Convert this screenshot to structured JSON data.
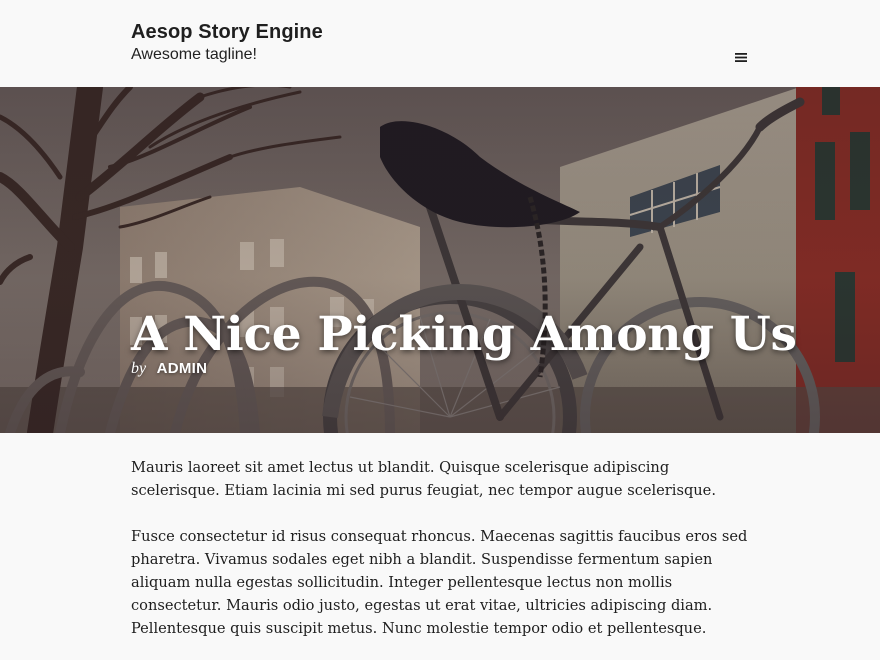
{
  "site": {
    "title": "Aesop Story Engine",
    "tagline": "Awesome tagline!"
  },
  "header": {
    "menu_icon": "hamburger-menu-icon"
  },
  "hero": {
    "title": "A Nice Picking Among Us",
    "byline_prefix": "by",
    "author": "ADMIN",
    "image_subject": "vintage bicycle at a bike rack in front of a brick building"
  },
  "content": {
    "paragraphs": [
      "Mauris laoreet sit amet lectus ut blandit. Quisque scelerisque adipiscing scelerisque. Etiam lacinia mi sed purus feugiat, nec tempor augue scelerisque.",
      "Fusce consectetur id risus consequat rhoncus. Maecenas sagittis faucibus eros sed pharetra. Vivamus sodales eget nibh a blandit. Suspendisse fermentum sapien aliquam nulla egestas sollicitudin. Integer pellentesque lectus non mollis consectetur. Mauris odio justo, egestas ut erat vitae, ultricies adipiscing diam. Pellentesque quis suscipit metus. Nunc molestie tempor odio et pellentesque."
    ]
  },
  "colors": {
    "page_background": "#f9f9f9",
    "text": "#1e1e1e",
    "hero_text": "#ffffff"
  }
}
